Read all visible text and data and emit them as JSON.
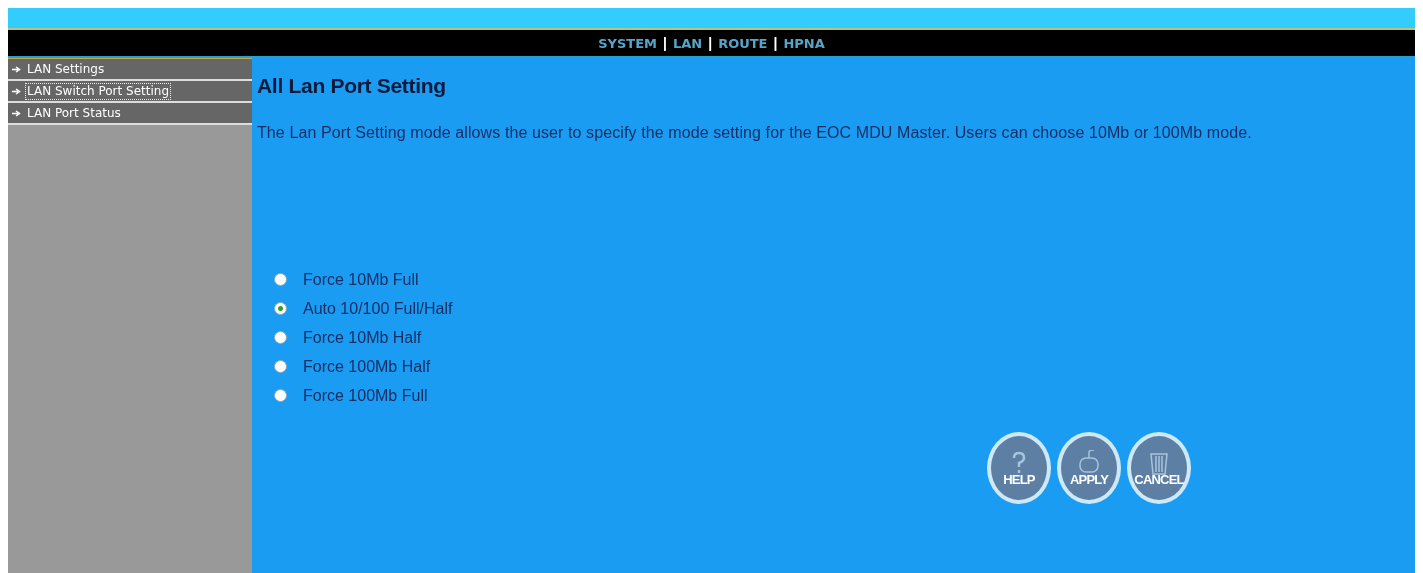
{
  "top_nav": [
    {
      "label": "SYSTEM"
    },
    {
      "label": "LAN",
      "separator": "|"
    },
    {
      "label": "ROUTE",
      "separator": "|"
    },
    {
      "label": "HPNA",
      "separator": "|"
    }
  ],
  "sidebar": {
    "items": [
      {
        "label": "LAN Settings",
        "selected": false
      },
      {
        "label": "LAN Switch Port Setting",
        "selected": true
      },
      {
        "label": "LAN Port Status",
        "selected": false
      }
    ]
  },
  "page": {
    "title": "All Lan Port Setting",
    "description": "The Lan Port Setting mode allows the user to specify the mode setting for the EOC MDU Master. Users can choose 10Mb or 100Mb mode."
  },
  "modes": [
    {
      "label": "Force 10Mb Full",
      "selected": false
    },
    {
      "label": "Auto 10/100 Full/Half",
      "selected": true
    },
    {
      "label": "Force 10Mb Half",
      "selected": false
    },
    {
      "label": "Force 100Mb Half",
      "selected": false
    },
    {
      "label": "Force 100Mb Full",
      "selected": false
    }
  ],
  "buttons": [
    {
      "label": "HELP",
      "kind": "help"
    },
    {
      "label": "APPLY",
      "kind": "apply"
    },
    {
      "label": "CANCEL",
      "kind": "cancel"
    }
  ]
}
